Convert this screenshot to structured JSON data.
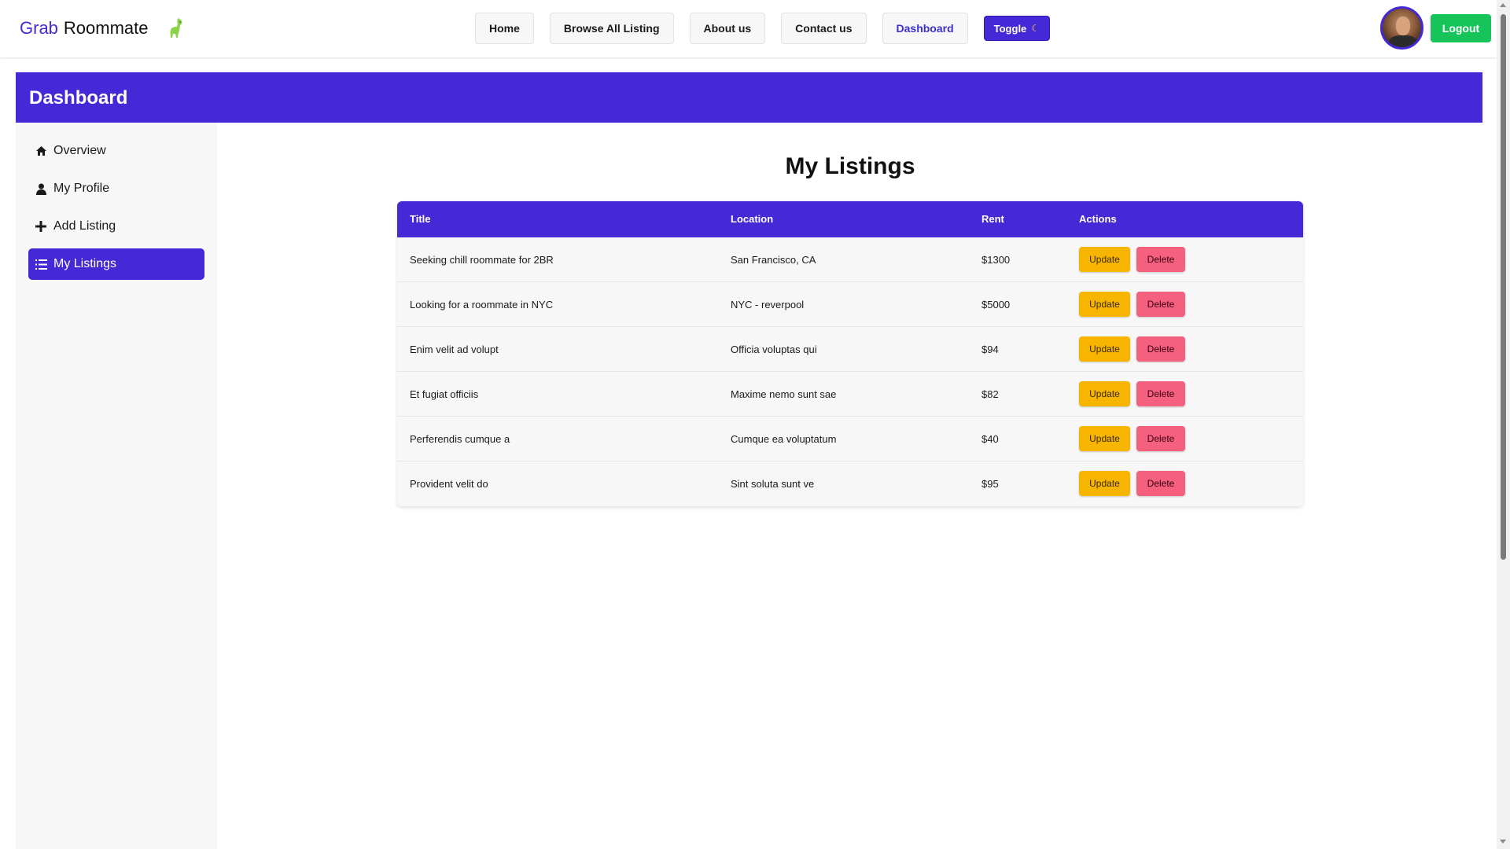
{
  "navbar": {
    "brand_part1": "Grab",
    "brand_part2": "Roommate",
    "logo_icon": "llama-icon",
    "links": [
      "Home",
      "Browse All Listing",
      "About us",
      "Contact us",
      "Dashboard"
    ],
    "active_link": "Dashboard",
    "toggle_label": "Toggle",
    "toggle_icon": "moon-icon",
    "logout_label": "Logout"
  },
  "dashboard": {
    "title": "Dashboard"
  },
  "sidebar": {
    "items": [
      {
        "label": "Overview",
        "icon": "home-icon"
      },
      {
        "label": "My Profile",
        "icon": "user-icon"
      },
      {
        "label": "Add Listing",
        "icon": "plus-icon"
      },
      {
        "label": "My Listings",
        "icon": "list-icon",
        "active": true
      }
    ]
  },
  "main": {
    "title": "My Listings",
    "table": {
      "headers": [
        "Title",
        "Location",
        "Rent",
        "Actions"
      ],
      "update_label": "Update",
      "delete_label": "Delete",
      "rows": [
        {
          "title": "Seeking chill roommate for 2BR",
          "location": "San Francisco, CA",
          "rent": "$1300"
        },
        {
          "title": "Looking for a roommate in NYC",
          "location": "NYC - reverpool",
          "rent": "$5000"
        },
        {
          "title": "Enim velit ad volupt",
          "location": "Officia voluptas qui",
          "rent": "$94"
        },
        {
          "title": "Et fugiat officiis",
          "location": "Maxime nemo sunt sae",
          "rent": "$82"
        },
        {
          "title": "Perferendis cumque a",
          "location": "Cumque ea voluptatum",
          "rent": "$40"
        },
        {
          "title": "Provident velit do",
          "location": "Sint soluta sunt ve",
          "rent": "$95"
        }
      ]
    }
  },
  "colors": {
    "primary": "#4528d6",
    "logout": "#16c45a",
    "update": "#f7b500",
    "delete": "#f4607e"
  }
}
